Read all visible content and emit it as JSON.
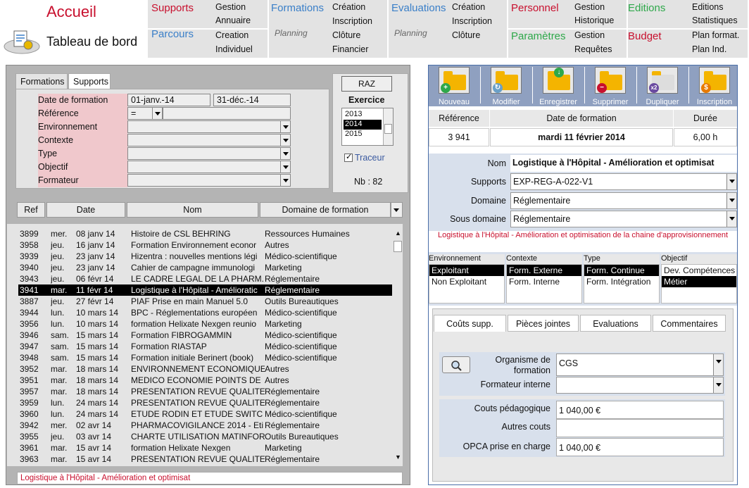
{
  "app": {
    "accueil": "Accueil",
    "dashboard": "Tableau de bord"
  },
  "menu": {
    "supports": {
      "title": "Supports",
      "items": [
        "Gestion",
        "Annuaire",
        "Creation",
        "Individuel"
      ]
    },
    "parcours": {
      "title": "Parcours"
    },
    "formations": {
      "title": "Formations",
      "planning": "Planning",
      "items": [
        "Création",
        "Inscription",
        "Clôture",
        "Financier"
      ]
    },
    "evaluations": {
      "title": "Evaluations",
      "planning": "Planning",
      "items": [
        "Création",
        "Inscription",
        "Clôture"
      ]
    },
    "personnel": {
      "title": "Personnel",
      "items": [
        "Gestion",
        "Historique"
      ]
    },
    "parametres": {
      "title": "Paramètres",
      "items": [
        "Gestion",
        "Requêtes"
      ]
    },
    "editions": {
      "title": "Editions",
      "items": [
        "Editions",
        "Statistiques"
      ]
    },
    "budget": {
      "title": "Budget",
      "items": [
        "Plan format.",
        "Plan Ind."
      ]
    }
  },
  "filters": {
    "tabs": [
      "Formations",
      "Supports"
    ],
    "labels": [
      "Date de formation",
      "Référence",
      "Environnement",
      "Contexte",
      "Type",
      "Objectif",
      "Formateur"
    ],
    "date_from": "01-janv.-14",
    "date_to": "31-déc.-14",
    "reference_op": "="
  },
  "exercice": {
    "raz": "RAZ",
    "label": "Exercice",
    "years": [
      "2013",
      "2014",
      "2015"
    ],
    "selected": "2014",
    "traceur": "Traceur",
    "count": "Nb : 82"
  },
  "grid": {
    "headers": [
      "Ref",
      "Date",
      "Nom",
      "Domaine de formation"
    ],
    "rows": [
      [
        "3899",
        "mer.",
        "08 janv 14",
        "Histoire de CSL BEHRING",
        "Ressources Humaines"
      ],
      [
        "3958",
        "jeu.",
        "16 janv 14",
        "Formation Environnement econor",
        "Autres"
      ],
      [
        "3939",
        "jeu.",
        "23 janv 14",
        "Hizentra : nouvelles mentions légi",
        "Médico-scientifique"
      ],
      [
        "3940",
        "jeu.",
        "23 janv 14",
        "Cahier de campagne immunologi",
        "Marketing"
      ],
      [
        "3943",
        "jeu.",
        "06 févr 14",
        "LE CADRE LEGAL DE LA PHARM.",
        "Réglementaire"
      ],
      [
        "3941",
        "mar.",
        "11 févr 14",
        "Logistique à l'Hôpital - Amélioratic",
        "Réglementaire"
      ],
      [
        "3887",
        "jeu.",
        "27 févr 14",
        "PIAF Prise en main Manuel 5.0",
        "Outils Bureautiques"
      ],
      [
        "3944",
        "lun.",
        "10 mars 14",
        "BPC - Réglementations européen",
        "Médico-scientifique"
      ],
      [
        "3956",
        "lun.",
        "10 mars 14",
        "formation Helixate Nexgen reunio",
        "Marketing"
      ],
      [
        "3946",
        "sam.",
        "15 mars 14",
        "Formation FIBROGAMMIN",
        "Médico-scientifique"
      ],
      [
        "3947",
        "sam.",
        "15 mars 14",
        "Formation RIASTAP",
        "Médico-scientifique"
      ],
      [
        "3948",
        "sam.",
        "15 mars 14",
        "Formation initiale Berinert (book)",
        "Médico-scientifique"
      ],
      [
        "3952",
        "mar.",
        "18 mars 14",
        "ENVIRONNEMENT ECONOMIQUE",
        "Autres"
      ],
      [
        "3951",
        "mar.",
        "18 mars 14",
        "MEDICO ECONOMIE POINTS DE",
        "Autres"
      ],
      [
        "3957",
        "mar.",
        "18 mars 14",
        "PRESENTATION REVUE QUALITE",
        "Réglementaire"
      ],
      [
        "3959",
        "lun.",
        "24 mars 14",
        "PRESENTATION REVUE QUALITE",
        "Réglementaire"
      ],
      [
        "3960",
        "lun.",
        "24 mars 14",
        "ETUDE RODIN ET ETUDE SWITC",
        "Médico-scientifique"
      ],
      [
        "3942",
        "mer.",
        "02 avr 14",
        "PHARMACOVIGILANCE 2014 - Eti",
        "Réglementaire"
      ],
      [
        "3955",
        "jeu.",
        "03 avr 14",
        "CHARTE UTILISATION MATINFOR",
        "Outils Bureautiques"
      ],
      [
        "3961",
        "mar.",
        "15 avr 14",
        "formation Helixate Nexgen",
        "Marketing"
      ],
      [
        "3963",
        "mar.",
        "15 avr 14",
        "PRESENTATION REVUE QUALITE",
        "Réglementaire"
      ]
    ],
    "selected_row": 5,
    "status": "Logistique à l'Hôpital - Amélioration et optimisat"
  },
  "toolbar": [
    "Nouveau",
    "Modifier",
    "Enregistrer",
    "Supprimer",
    "Dupliquer",
    "Inscription"
  ],
  "detail": {
    "headers": [
      "Référence",
      "Date de formation",
      "Durée"
    ],
    "reference": "3 941",
    "date": "mardi 11 février 2014",
    "duree": "6,00 h",
    "nom_label": "Nom",
    "nom": "Logistique à l'Hôpital - Amélioration et optimisat",
    "supports_label": "Supports",
    "supports": "EXP-REG-A-022-V1",
    "domaine_label": "Domaine",
    "domaine": "Réglementaire",
    "sousdomaine_label": "Sous domaine",
    "sousdomaine": "Réglementaire",
    "full_title": "Logistique à l'Hôpital - Amélioration et optimisation de la chaine d'approvisionnement"
  },
  "lists": {
    "environnement": {
      "title": "Environnement",
      "items": [
        "Exploitant",
        "Non Exploitant"
      ],
      "selected": 0
    },
    "contexte": {
      "title": "Contexte",
      "items": [
        "Form. Externe",
        "Form. Interne"
      ],
      "selected": 0
    },
    "type": {
      "title": "Type",
      "items": [
        "Form. Continue",
        "Form. Intégration"
      ],
      "selected": 0
    },
    "objectif": {
      "title": "Objectif",
      "items": [
        "Dev. Compétences",
        "Métier"
      ],
      "selected": 1
    }
  },
  "bottom_tabs": [
    "Coûts supp.",
    "Pièces jointes",
    "Evaluations",
    "Commentaires"
  ],
  "costs": {
    "organisme_label": "Organisme de formation",
    "organisme": "CGS",
    "formateur_label": "Formateur interne",
    "formateur": "",
    "couts_peda_label": "Couts pédagogique",
    "couts_peda": "1 040,00 €",
    "autres_label": "Autres couts",
    "autres": "",
    "opca_label": "OPCA prise en charge",
    "opca": "1 040,00 €"
  },
  "colors": {
    "accent_red": "#c8102e",
    "menu_blue": "#3a7fc8",
    "menu_green": "#2ea84a",
    "toolbar": "#8fa0c0"
  }
}
